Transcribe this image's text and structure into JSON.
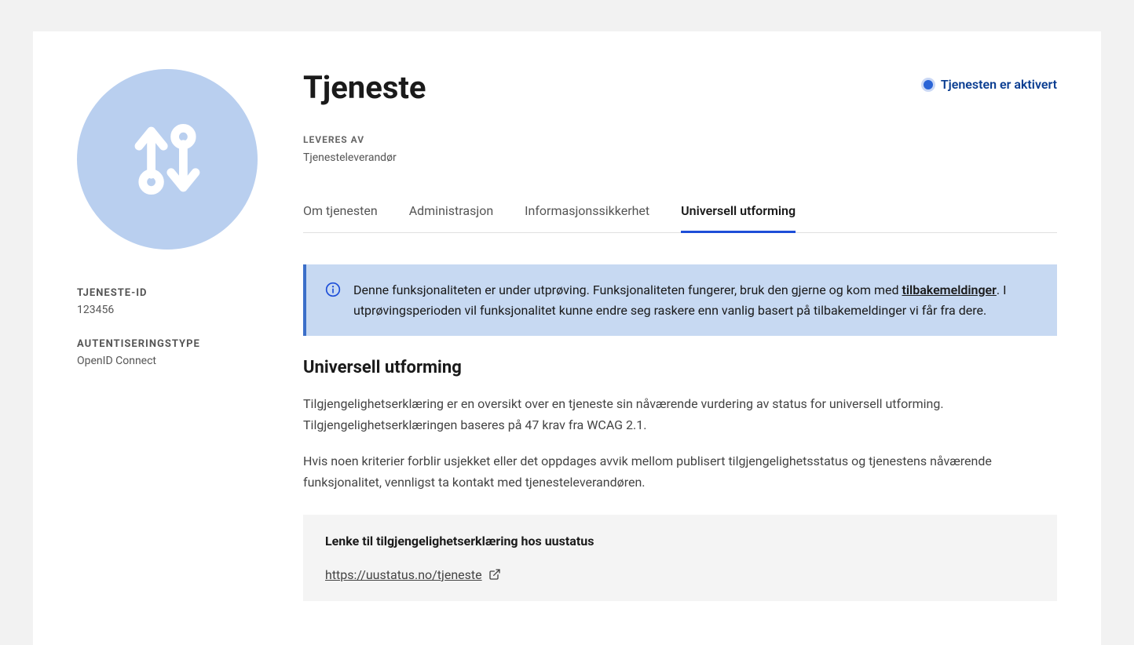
{
  "header": {
    "title": "Tjeneste",
    "status_label": "Tjenesten er aktivert"
  },
  "delivered": {
    "label": "LEVERES AV",
    "value": "Tjenesteleverandør"
  },
  "sidebar": {
    "id_label": "TJENESTE-ID",
    "id_value": "123456",
    "auth_label": "AUTENTISERINGSTYPE",
    "auth_value": "OpenID Connect"
  },
  "tabs": [
    {
      "label": "Om tjenesten",
      "active": false
    },
    {
      "label": "Administrasjon",
      "active": false
    },
    {
      "label": "Informasjonssikkerhet",
      "active": false
    },
    {
      "label": "Universell utforming",
      "active": true
    }
  ],
  "banner": {
    "text_before": "Denne funksjonaliteten er under utprøving. Funksjonaliteten fungerer, bruk den gjerne og kom med ",
    "link_text": "tilbakemeldinger",
    "text_after": ". I utprøvingsperioden vil funksjonalitet kunne endre seg raskere enn vanlig basert på tilbakemeldinger vi får fra dere."
  },
  "section": {
    "heading": "Universell utforming",
    "para1": "Tilgjengelighetserklæring er en oversikt over en tjeneste sin nåværende vurdering av status for universell utforming. Tilgjengelighetserklæringen baseres på 47 krav fra WCAG 2.1.",
    "para2": "Hvis noen kriterier forblir usjekket eller det oppdages avvik mellom publisert tilgjengelighetsstatus og tjenestens nåværende funksjonalitet, vennligst ta kontakt med tjenesteleverandøren."
  },
  "link_block": {
    "heading": "Lenke til tilgjengelighetserklæring hos uustatus",
    "url": "https://uustatus.no/tjeneste"
  }
}
